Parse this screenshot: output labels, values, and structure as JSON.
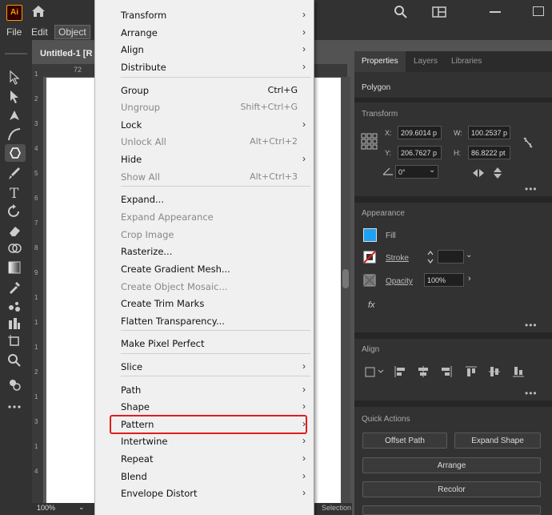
{
  "app": {
    "logo": "Ai"
  },
  "menubar": {
    "items": [
      "File",
      "Edit",
      "Object"
    ]
  },
  "document": {
    "tab_title": "Untitled-1 [R",
    "ruler_mark": "72"
  },
  "bottom": {
    "zoom": "100%",
    "status": "Selection"
  },
  "vruler_labels": [
    "1",
    "2",
    "3",
    "4",
    "5",
    "6",
    "7",
    "8",
    "9",
    "1",
    "1",
    "1",
    "2",
    "1",
    "3",
    "1",
    "4"
  ],
  "dropdown": {
    "items": [
      {
        "label": "Transform",
        "shortcut": "",
        "submenu": true,
        "disabled": false
      },
      {
        "label": "Arrange",
        "shortcut": "",
        "submenu": true,
        "disabled": false
      },
      {
        "label": "Align",
        "shortcut": "",
        "submenu": true,
        "disabled": false
      },
      {
        "label": "Distribute",
        "shortcut": "",
        "submenu": true,
        "disabled": false
      },
      {
        "label": "Group",
        "shortcut": "Ctrl+G",
        "submenu": false,
        "disabled": false
      },
      {
        "label": "Ungroup",
        "shortcut": "Shift+Ctrl+G",
        "submenu": false,
        "disabled": true
      },
      {
        "label": "Lock",
        "shortcut": "",
        "submenu": true,
        "disabled": false
      },
      {
        "label": "Unlock All",
        "shortcut": "Alt+Ctrl+2",
        "submenu": false,
        "disabled": true
      },
      {
        "label": "Hide",
        "shortcut": "",
        "submenu": true,
        "disabled": false
      },
      {
        "label": "Show All",
        "shortcut": "Alt+Ctrl+3",
        "submenu": false,
        "disabled": true
      },
      {
        "label": "Expand...",
        "shortcut": "",
        "submenu": false,
        "disabled": false
      },
      {
        "label": "Expand Appearance",
        "shortcut": "",
        "submenu": false,
        "disabled": true
      },
      {
        "label": "Crop Image",
        "shortcut": "",
        "submenu": false,
        "disabled": true
      },
      {
        "label": "Rasterize...",
        "shortcut": "",
        "submenu": false,
        "disabled": false
      },
      {
        "label": "Create Gradient Mesh...",
        "shortcut": "",
        "submenu": false,
        "disabled": false
      },
      {
        "label": "Create Object Mosaic...",
        "shortcut": "",
        "submenu": false,
        "disabled": true
      },
      {
        "label": "Create Trim Marks",
        "shortcut": "",
        "submenu": false,
        "disabled": false
      },
      {
        "label": "Flatten Transparency...",
        "shortcut": "",
        "submenu": false,
        "disabled": false
      },
      {
        "label": "Make Pixel Perfect",
        "shortcut": "",
        "submenu": false,
        "disabled": false
      },
      {
        "label": "Slice",
        "shortcut": "",
        "submenu": true,
        "disabled": false
      },
      {
        "label": "Path",
        "shortcut": "",
        "submenu": true,
        "disabled": false
      },
      {
        "label": "Shape",
        "shortcut": "",
        "submenu": true,
        "disabled": false
      },
      {
        "label": "Pattern",
        "shortcut": "",
        "submenu": true,
        "disabled": false,
        "highlighted": true
      },
      {
        "label": "Intertwine",
        "shortcut": "",
        "submenu": true,
        "disabled": false
      },
      {
        "label": "Repeat",
        "shortcut": "",
        "submenu": true,
        "disabled": false
      },
      {
        "label": "Blend",
        "shortcut": "",
        "submenu": true,
        "disabled": false
      },
      {
        "label": "Envelope Distort",
        "shortcut": "",
        "submenu": true,
        "disabled": false
      }
    ]
  },
  "panel": {
    "tabs": [
      "Properties",
      "Layers",
      "Libraries"
    ],
    "object_type": "Polygon",
    "transform": {
      "title": "Transform",
      "x_label": "X:",
      "x": "209.6014 p",
      "y_label": "Y:",
      "y": "206.7627 p",
      "w_label": "W:",
      "w": "100.2537 p",
      "h_label": "H:",
      "h": "86.8222 pt",
      "angle": "0°"
    },
    "appearance": {
      "title": "Appearance",
      "fill": "Fill",
      "stroke": "Stroke",
      "opacity_label": "Opacity",
      "opacity": "100%",
      "fx": "fx"
    },
    "align": {
      "title": "Align"
    },
    "quick_actions": {
      "title": "Quick Actions",
      "offset_path": "Offset Path",
      "expand_shape": "Expand Shape",
      "arrange": "Arrange",
      "recolor": "Recolor"
    }
  },
  "colors": {
    "accent": "#1ea1f2",
    "highlight_border": "#e01e1e",
    "stroke_swatch": "#e02020"
  }
}
